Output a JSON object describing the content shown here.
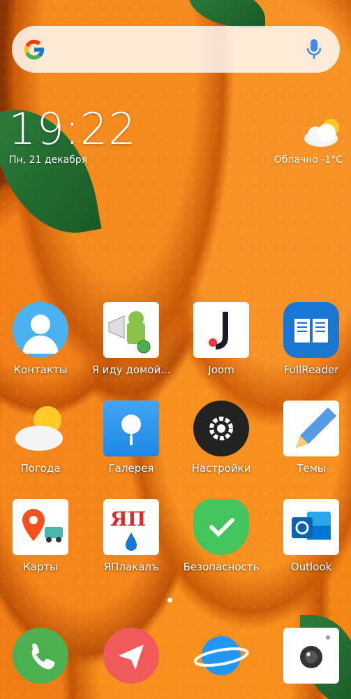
{
  "search": {
    "placeholder": ""
  },
  "clock": {
    "time": "19:22",
    "date": "Пн, 21 декабря"
  },
  "weather": {
    "text": "Облачно   -1°C"
  },
  "apps": [
    {
      "label": "Контакты"
    },
    {
      "label": "Я иду домой..."
    },
    {
      "label": "Joom"
    },
    {
      "label": "FullReader"
    },
    {
      "label": "Погода"
    },
    {
      "label": "Галерея"
    },
    {
      "label": "Настройки"
    },
    {
      "label": "Темы"
    },
    {
      "label": "Карты"
    },
    {
      "label": "ЯПлакалъ"
    },
    {
      "label": "Безопасность"
    },
    {
      "label": "Outlook"
    }
  ],
  "icon_text": {
    "jp": "ЯП"
  },
  "dock": [
    {
      "icon": "phone-icon"
    },
    {
      "icon": "messages-icon"
    },
    {
      "icon": "browser-icon"
    },
    {
      "icon": "camera-icon"
    }
  ],
  "colors": {
    "accent_blue": "#1e88e5",
    "wallpaper_orange": "#f58a1f"
  }
}
